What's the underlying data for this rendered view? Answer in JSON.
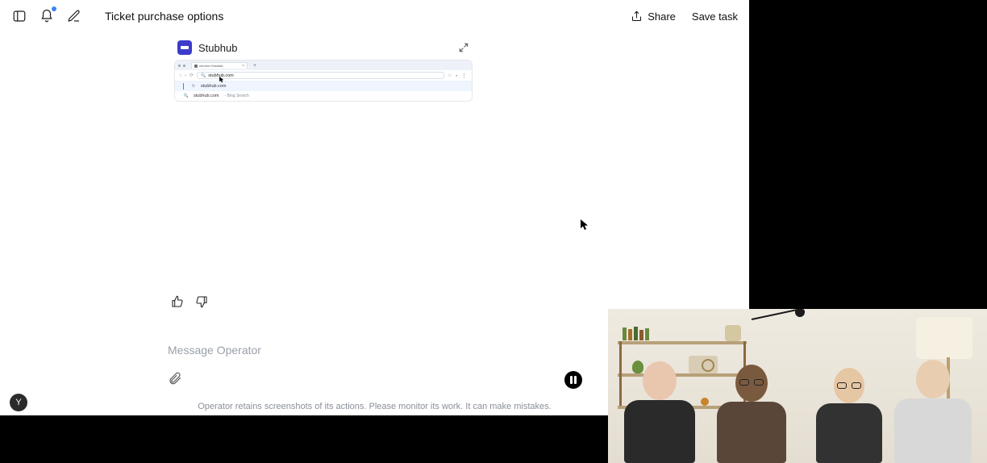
{
  "header": {
    "title": "Ticket purchase options",
    "share_label": "Share",
    "save_label": "Save task"
  },
  "browser_card": {
    "service": "Stubhub",
    "tab_label": "chrome://newtab",
    "typed_url": "stubhub.com",
    "suggestions": [
      {
        "icon": "history",
        "text": "stubhub.com",
        "sub": ""
      },
      {
        "icon": "search",
        "text": "stubhub.com",
        "sub": "- Bing Search"
      }
    ]
  },
  "feedback": {
    "up_title": "Good",
    "down_title": "Bad"
  },
  "composer": {
    "placeholder": "Message Operator"
  },
  "disclaimer": "Operator retains screenshots of its actions. Please monitor its work. It can make mistakes.",
  "avatar_initial": "Y"
}
